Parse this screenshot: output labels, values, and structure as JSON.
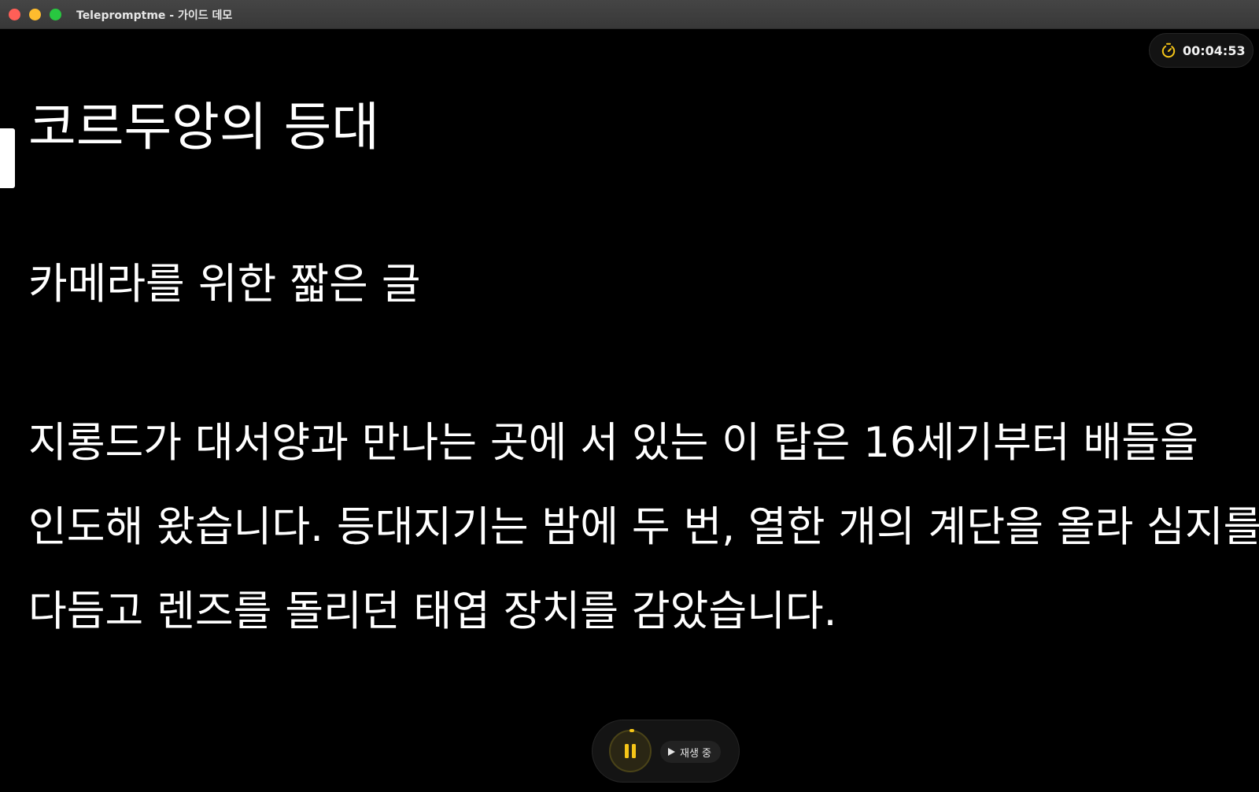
{
  "window": {
    "title": "Telepromptme - 가이드 데모"
  },
  "timer": {
    "icon": "timer-icon",
    "elapsed": "00:04:53",
    "accent_color": "#f5c518"
  },
  "script": {
    "title": "코르두앙의 등대",
    "subtitle": "카메라를 위한 짧은 글",
    "body_lines": [
      "지롱드가 대서양과 만나는 곳에 서 있는 이 탑은 16세기부터 배들을",
      "인도해 왔습니다. 등대지기는 밤에 두 번, 열한 개의 계단을 올라 심지를",
      "다듬고 렌즈를 돌리던 태엽 장치를 감았습니다."
    ]
  },
  "controls": {
    "pause_icon": "pause-icon",
    "status_icon": "play-icon",
    "status_label": "재생 중"
  }
}
